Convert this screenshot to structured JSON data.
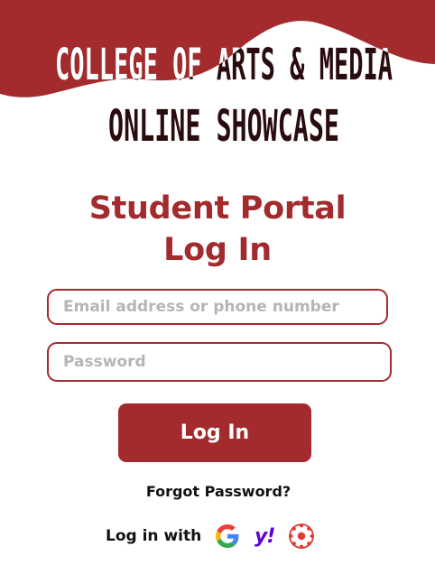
{
  "banner": {
    "title_line1": "COLLEGE OF ARTS & MEDIA",
    "title_line2": "ONLINE SHOWCASE"
  },
  "portal": {
    "heading_line1": "Student Portal",
    "heading_line2": "Log In"
  },
  "form": {
    "email_placeholder": "Email address or phone number",
    "email_value": "",
    "password_placeholder": "Password",
    "password_value": "",
    "login_label": "Log In",
    "forgot_label": "Forgot Password?"
  },
  "social": {
    "label": "Log in with",
    "providers": [
      {
        "name": "google-icon"
      },
      {
        "name": "yahoo-icon",
        "glyph": "y!"
      },
      {
        "name": "canvas-icon"
      }
    ]
  },
  "colors": {
    "brand": "#a32a2d",
    "placeholder": "#b5b5b5",
    "yahoo": "#5f01d1"
  }
}
